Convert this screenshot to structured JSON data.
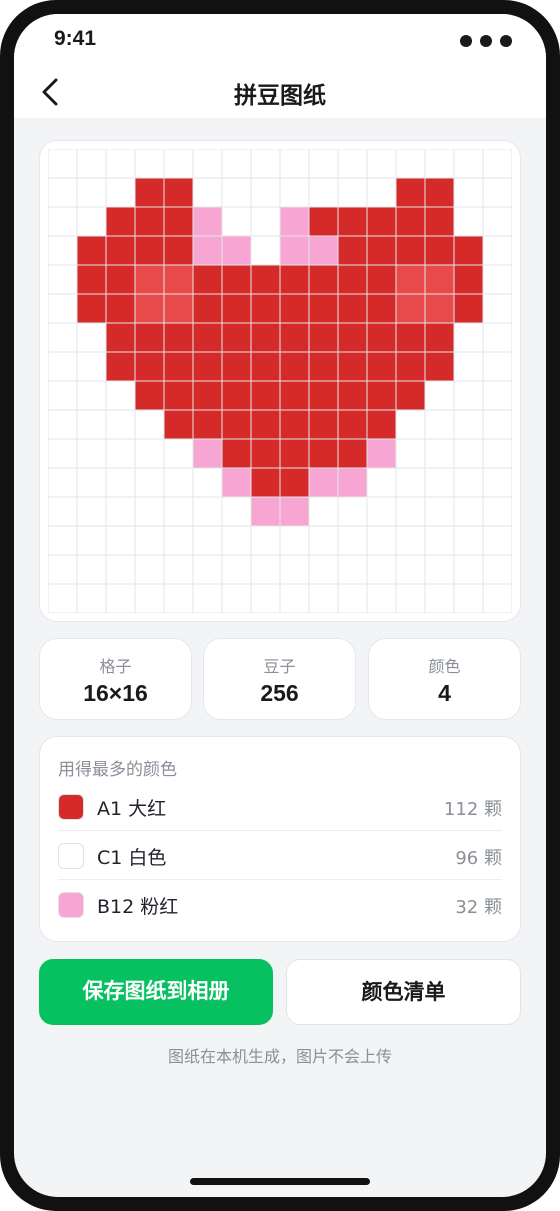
{
  "status_bar": {
    "time": "9:41"
  },
  "nav": {
    "title": "拼豆图纸",
    "back_icon": "chevron-left-icon"
  },
  "pattern": {
    "columns": 16,
    "rows": 16,
    "palette": {
      ".": "#ffffff",
      "R": "#d42a2a",
      "L": "#e84a4a",
      "P": "#f7a6d3"
    },
    "gridline_color": "#e3e5e8",
    "cells": [
      "................",
      "...RR.......RR..",
      "..RRRP..PRRRRR..",
      ".RRRRPP.PPRRRRR.",
      ".RRLLRRRRRRRLLR.",
      ".RRLLRRRRRRRLLR.",
      "..RRRRRRRRRRRR..",
      "..RRRRRRRRRRRR..",
      "...RRRRRRRRRR...",
      "....RRRRRRRR....",
      ".....PRRRRRP....",
      "......PRRPP.....",
      ".......PP.......",
      "................",
      "................",
      "................"
    ]
  },
  "stats": [
    {
      "label": "格子",
      "value": "16×16"
    },
    {
      "label": "豆子",
      "value": "256"
    },
    {
      "label": "颜色",
      "value": "4"
    }
  ],
  "top_colors": {
    "title": "用得最多的颜色",
    "items": [
      {
        "name": "A1 大红",
        "count": "112 颗",
        "color": "#d42a2a"
      },
      {
        "name": "C1 白色",
        "count": "96 颗",
        "color": "#ffffff"
      },
      {
        "name": "B12 粉红",
        "count": "32 颗",
        "color": "#f7a6d3"
      }
    ]
  },
  "actions": {
    "save_label": "保存图纸到相册",
    "list_label": "颜色清单"
  },
  "footnote": "图纸在本机生成，图片不会上传"
}
